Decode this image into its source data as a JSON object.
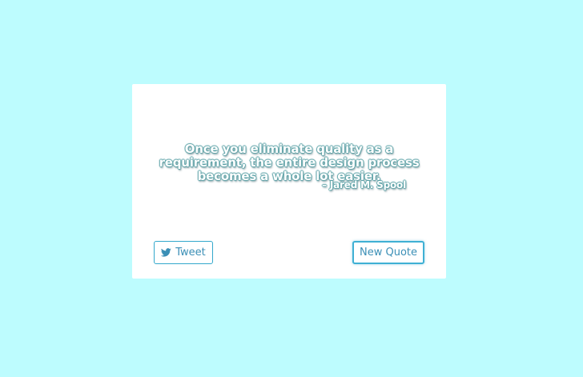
{
  "quote": {
    "text": "Once you eliminate quality as a requirement, the entire design process becomes a whole lot easier.",
    "author": "– Jared M. Spool"
  },
  "buttons": {
    "tweet_label": "Tweet",
    "new_quote_label": "New Quote"
  },
  "colors": {
    "background": "#bdfcfe",
    "card": "#ffffff",
    "button_border": "#33a8cc",
    "button_text": "#3b8fb6"
  },
  "icons": {
    "tweet": "twitter-icon"
  }
}
